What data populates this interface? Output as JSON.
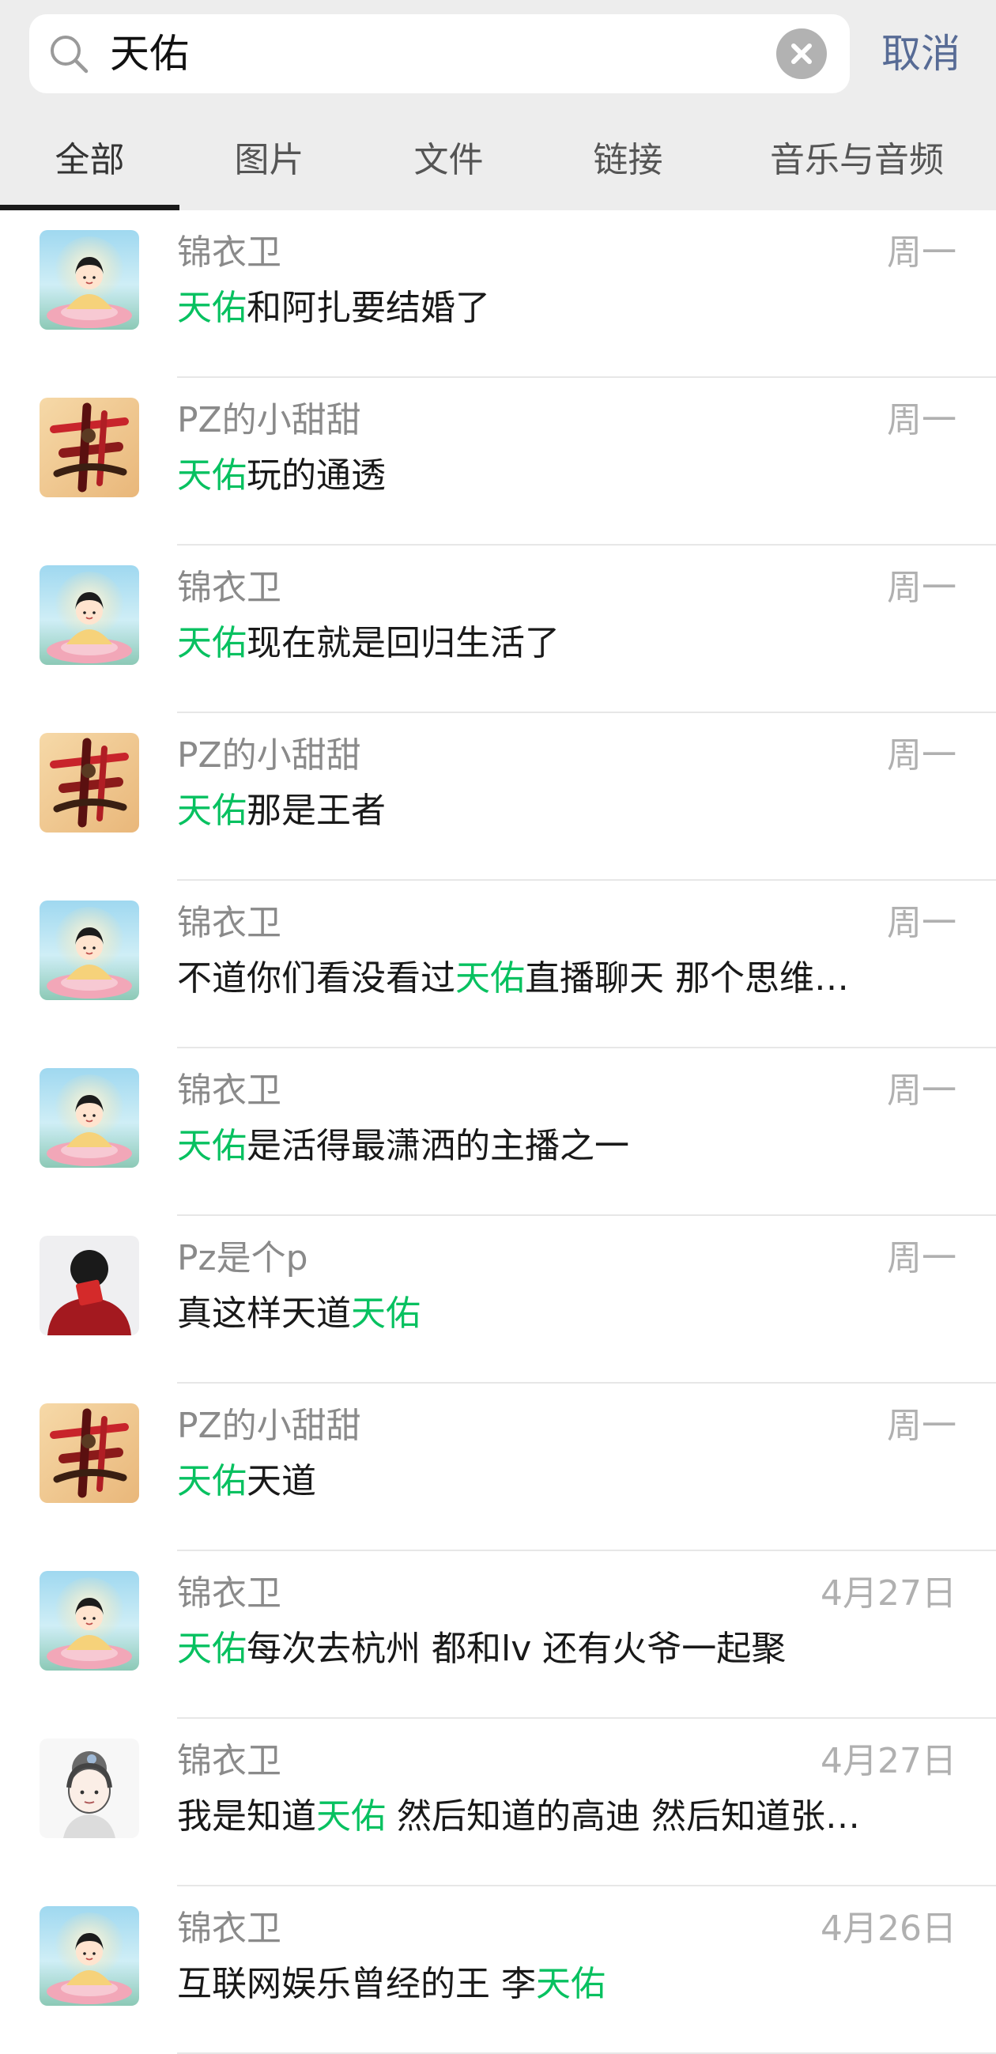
{
  "search": {
    "query": "天佑",
    "cancel_label": "取消"
  },
  "tabs": [
    {
      "label": "全部"
    },
    {
      "label": "图片"
    },
    {
      "label": "文件"
    },
    {
      "label": "链接"
    },
    {
      "label": "音乐与音频"
    }
  ],
  "colors": {
    "highlight": "#07c160",
    "cancel": "#576b95"
  },
  "results": [
    {
      "sender": "锦衣卫",
      "date": "周一",
      "avatar": "buddha-avatar",
      "parts": [
        "",
        "天佑",
        "和阿扎要结婚了"
      ]
    },
    {
      "sender": "PZ的小甜甜",
      "date": "周一",
      "avatar": "calligraphy-avatar",
      "parts": [
        "",
        "天佑",
        "玩的通透"
      ]
    },
    {
      "sender": "锦衣卫",
      "date": "周一",
      "avatar": "buddha-avatar",
      "parts": [
        "",
        "天佑",
        "现在就是回归生活了"
      ]
    },
    {
      "sender": "PZ的小甜甜",
      "date": "周一",
      "avatar": "calligraphy-avatar",
      "parts": [
        "",
        "天佑",
        "那是王者"
      ]
    },
    {
      "sender": "锦衣卫",
      "date": "周一",
      "avatar": "buddha-avatar",
      "parts": [
        "不道你们看没看过",
        "天佑",
        "直播聊天 那个思维…"
      ]
    },
    {
      "sender": "锦衣卫",
      "date": "周一",
      "avatar": "buddha-avatar",
      "parts": [
        "",
        "天佑",
        "是活得最潇洒的主播之一"
      ]
    },
    {
      "sender": "Pz是个p",
      "date": "周一",
      "avatar": "person-avatar",
      "parts": [
        "真这样天道",
        "天佑",
        ""
      ]
    },
    {
      "sender": "PZ的小甜甜",
      "date": "周一",
      "avatar": "calligraphy-avatar",
      "parts": [
        "",
        "天佑",
        "天道"
      ]
    },
    {
      "sender": "锦衣卫",
      "date": "4月27日",
      "avatar": "buddha-avatar",
      "parts": [
        "",
        "天佑",
        "每次去杭州 都和lv 还有火爷一起聚"
      ]
    },
    {
      "sender": "锦衣卫",
      "date": "4月27日",
      "avatar": "sketch-girl-avatar",
      "parts": [
        "我是知道",
        "天佑",
        " 然后知道的高迪 然后知道张…"
      ]
    },
    {
      "sender": "锦衣卫",
      "date": "4月26日",
      "avatar": "buddha-avatar",
      "parts": [
        "互联网娱乐曾经的王 李",
        "天佑",
        ""
      ]
    }
  ]
}
